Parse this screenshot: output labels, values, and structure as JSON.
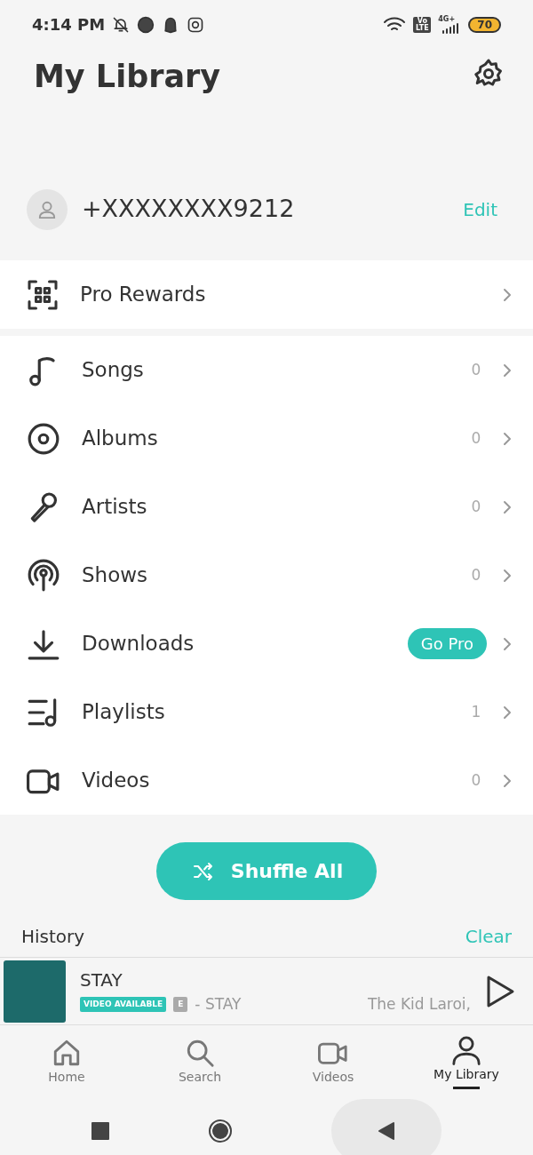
{
  "status_bar": {
    "time": "4:14 PM",
    "volte": "Vo LTE",
    "network": "4G+",
    "battery": "70"
  },
  "header": {
    "title": "My Library"
  },
  "profile": {
    "phone": "+XXXXXXXX9212",
    "edit": "Edit"
  },
  "rewards": {
    "label": "Pro Rewards"
  },
  "library_items": [
    {
      "label": "Songs",
      "kind": "count",
      "value": "0"
    },
    {
      "label": "Albums",
      "kind": "count",
      "value": "0"
    },
    {
      "label": "Artists",
      "kind": "count",
      "value": "0"
    },
    {
      "label": "Shows",
      "kind": "count",
      "value": "0"
    },
    {
      "label": "Downloads",
      "kind": "pro",
      "value": "Go Pro"
    },
    {
      "label": "Playlists",
      "kind": "count",
      "value": "1"
    },
    {
      "label": "Videos",
      "kind": "count",
      "value": "0"
    }
  ],
  "shuffle_button": "Shuffle All",
  "history": {
    "title": "History",
    "clear": "Clear",
    "track": {
      "title": "STAY",
      "badge": "VIDEO AVAILABLE",
      "explicit": "E",
      "album": "- STAY",
      "artist": "The Kid Laroi,"
    }
  },
  "bottom_nav": [
    {
      "label": "Home",
      "selected": false
    },
    {
      "label": "Search",
      "selected": false
    },
    {
      "label": "Videos",
      "selected": false
    },
    {
      "label": "My Library",
      "selected": true
    }
  ]
}
